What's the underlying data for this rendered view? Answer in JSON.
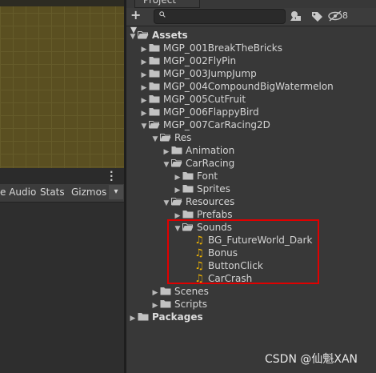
{
  "project_tab": {
    "title": "Project"
  },
  "toolbar": {
    "add_label": "+ ▾",
    "search_placeholder": "",
    "hidden_count": "8"
  },
  "game_toolbar": {
    "audio_label": "e Audio",
    "stats_label": "Stats",
    "gizmos_label": "Gizmos",
    "gizmos_arrow": "▾"
  },
  "tree": [
    {
      "label": "Assets",
      "kind": "folder",
      "open": true,
      "bold": true
    },
    {
      "label": "MGP_001BreakTheBricks",
      "kind": "folder",
      "open": false
    },
    {
      "label": "MGP_002FlyPin",
      "kind": "folder",
      "open": false
    },
    {
      "label": "MGP_003JumpJump",
      "kind": "folder",
      "open": false
    },
    {
      "label": "MGP_004CompoundBigWatermelon",
      "kind": "folder",
      "open": false
    },
    {
      "label": "MGP_005CutFruit",
      "kind": "folder",
      "open": false
    },
    {
      "label": "MGP_006FlappyBird",
      "kind": "folder",
      "open": false
    },
    {
      "label": "MGP_007CarRacing2D",
      "kind": "folder",
      "open": true
    },
    {
      "label": "Res",
      "kind": "folder",
      "open": true
    },
    {
      "label": "Animation",
      "kind": "folder",
      "open": false
    },
    {
      "label": "CarRacing",
      "kind": "folder",
      "open": true
    },
    {
      "label": "Font",
      "kind": "folder",
      "open": false
    },
    {
      "label": "Sprites",
      "kind": "folder",
      "open": false
    },
    {
      "label": "Resources",
      "kind": "folder",
      "open": true
    },
    {
      "label": "Prefabs",
      "kind": "folder",
      "open": false
    },
    {
      "label": "Sounds",
      "kind": "folder",
      "open": true
    },
    {
      "label": "BG_FutureWorld_Dark",
      "kind": "audio"
    },
    {
      "label": "Bonus",
      "kind": "audio"
    },
    {
      "label": "ButtonClick",
      "kind": "audio"
    },
    {
      "label": "CarCrash",
      "kind": "audio"
    },
    {
      "label": "Scenes",
      "kind": "folder",
      "open": false
    },
    {
      "label": "Scripts",
      "kind": "folder",
      "open": false
    },
    {
      "label": "Packages",
      "kind": "folder",
      "open": false,
      "bold": true
    }
  ],
  "watermark": "CSDN @仙魁XAN",
  "colors": {
    "highlight": "#e00000",
    "audio_icon": "#f0b400",
    "folder_icon": "#c2c2c2"
  }
}
